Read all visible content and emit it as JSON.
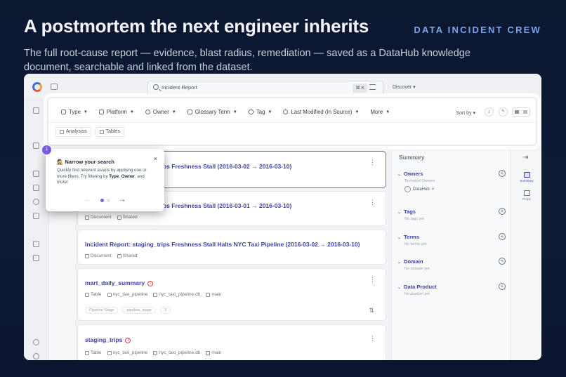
{
  "header": {
    "headline": "A postmortem the next engineer inherits",
    "crew": "DATA INCIDENT CREW",
    "subtitle": "The full root-cause report — evidence, blast radius, remediation — saved as a DataHub knowledge document, searchable and linked from the dataset."
  },
  "topbar": {
    "search_value": "Incident Report",
    "shortcut": "⌘ K",
    "discover_label": "Discover"
  },
  "filters": {
    "items": [
      {
        "label": "Type",
        "icon": "type-icon"
      },
      {
        "label": "Platform",
        "icon": "platform-icon"
      },
      {
        "label": "Owner",
        "icon": "owner-icon"
      },
      {
        "label": "Glossary Term",
        "icon": "book-icon"
      },
      {
        "label": "Tag",
        "icon": "tag-icon"
      },
      {
        "label": "Last Modified (In Source)",
        "icon": "clock-icon"
      },
      {
        "label": "More",
        "icon": ""
      }
    ],
    "sort_label": "Sort by",
    "chips": [
      {
        "label": "Analysiss"
      },
      {
        "label": "Tables"
      }
    ]
  },
  "results": [
    {
      "title": "Incident Report: staging_trips Freshness Stall (2016-03-02 → 2016-03-10)",
      "meta": [
        "Document",
        "Shared"
      ],
      "warn": false
    },
    {
      "title": "Incident Report: staging_trips Freshness Stall (2016-03-01 → 2016-03-10)",
      "meta": [
        "Document",
        "Shared"
      ],
      "warn": false
    },
    {
      "title": "Incident Report: staging_trips Freshness Stall Halts NYC Taxi Pipeline (2016-03-02 → 2016-03-10)",
      "meta": [
        "Document",
        "Shared"
      ],
      "warn": false
    },
    {
      "title": "mart_daily_summary",
      "meta": [
        "Table",
        "nyc_taxi_pipeline",
        "nyc_taxi_pipeline.db",
        "main"
      ],
      "sub": [
        "Pipeline Stage",
        "pipeline_stage",
        "3"
      ],
      "warn": true
    },
    {
      "title": "staging_trips",
      "meta": [
        "Table",
        "nyc_taxi_pipeline",
        "nyc_taxi_pipeline.db",
        "main"
      ],
      "warn": true
    }
  ],
  "summary": {
    "title": "Summary",
    "sections": [
      {
        "label": "Owners",
        "value": "Technical Owners",
        "owner": "DataHub"
      },
      {
        "label": "Tags",
        "value": "No tags yet"
      },
      {
        "label": "Terms",
        "value": "No terms yet"
      },
      {
        "label": "Domain",
        "value": "No domain yet"
      },
      {
        "label": "Data Product",
        "value": "No product yet"
      }
    ]
  },
  "right_rail": {
    "summary_label": "Summary",
    "props_label": "Props"
  },
  "tour": {
    "step": "1",
    "title": "🕵 Narrow your search",
    "body_pre": "Quickly find relevant assets by applying one or more filters. Try filtering by ",
    "body_b1": "Type",
    "body_mid": ", ",
    "body_b2": "Owner",
    "body_post": ", and more!",
    "close": "×",
    "current_step": 1,
    "total_steps": 2
  },
  "colors": {
    "accent": "#3c3fa8",
    "tour_badge": "#7c5ce0",
    "crew": "#79a6ee",
    "warn": "#d64545"
  }
}
